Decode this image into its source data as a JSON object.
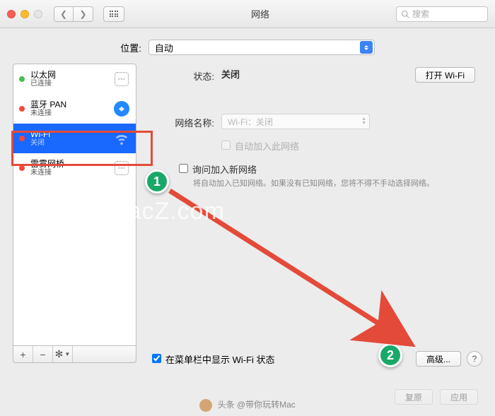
{
  "window": {
    "title": "网络",
    "search_placeholder": "搜索"
  },
  "location": {
    "label": "位置:",
    "value": "自动"
  },
  "sidebar": {
    "items": [
      {
        "name": "以太网",
        "sub": "已连接",
        "status": "green",
        "icon": "diamond"
      },
      {
        "name": "蓝牙 PAN",
        "sub": "未连接",
        "status": "red",
        "icon": "bluetooth"
      },
      {
        "name": "Wi-Fi",
        "sub": "关闭",
        "status": "red",
        "icon": "wifi",
        "selected": true
      },
      {
        "name": "雷雾网桥",
        "sub": "未连接",
        "status": "red",
        "icon": "diamond"
      }
    ],
    "foot": {
      "add": "+",
      "remove": "−",
      "gear": "✻▾"
    }
  },
  "detail": {
    "status_label": "状态:",
    "status_value": "关闭",
    "toggle_button": "打开 Wi-Fi",
    "netname_label": "网络名称:",
    "netname_value": "Wi-Fi：关闭",
    "auto_join": "自动加入此网络",
    "ask_join": "询问加入新网络",
    "ask_desc": "将自动加入已知网络。如果没有已知网络，您将不得不手动选择网络。",
    "show_menu": "在菜单栏中显示 Wi-Fi 状态",
    "advanced": "高级...",
    "help": "?"
  },
  "footer": {
    "revert": "复原",
    "apply": "应用"
  },
  "annotations": {
    "badge1": "1",
    "badge2": "2",
    "watermark": "www.MacZ.com",
    "byline_prefix": "头条",
    "byline_author": "@带你玩转Mac"
  }
}
